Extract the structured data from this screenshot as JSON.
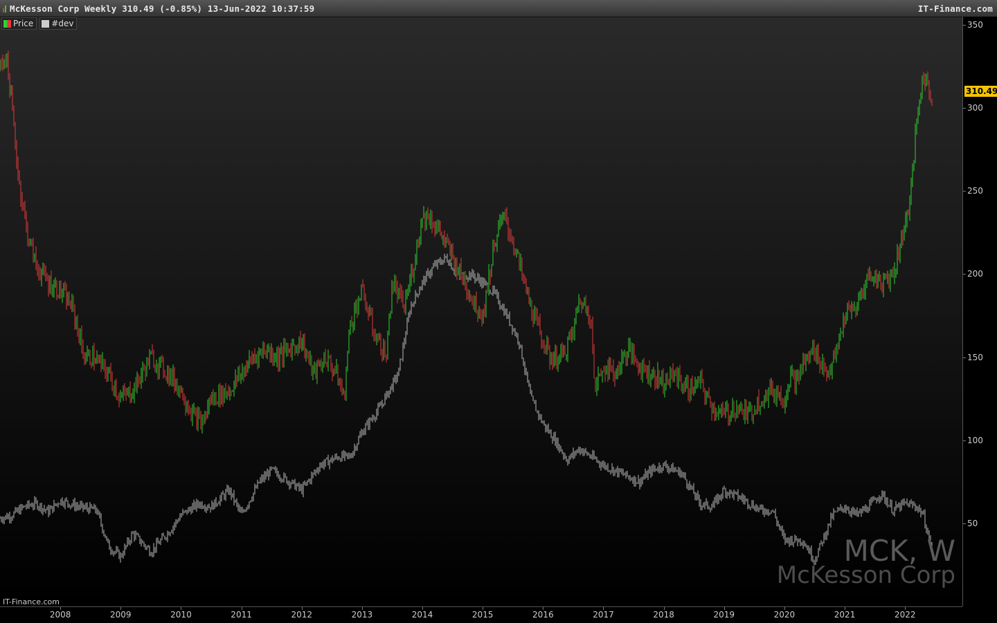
{
  "header": {
    "title": "McKesson Corp Weekly 310.49 (-0.85%) 13-Jun-2022 10:37:59",
    "site": "IT-Finance.com"
  },
  "legend": [
    {
      "label": "Price",
      "color": "#44cc44"
    },
    {
      "label": "#dev",
      "color": "#cccccc"
    }
  ],
  "last_price": "310.49",
  "watermark": {
    "code": "MCK, W",
    "name": "McKesson Corp"
  },
  "source": "IT-Finance.com",
  "colors": {
    "up": "#2fd12f",
    "down": "#e03a3a",
    "badge": "#f5c400",
    "background": "#000000"
  },
  "chart_data": {
    "type": "line",
    "title": "McKesson Corp Weekly 310.49 (-0.85%) 13-Jun-2022 10:37:59",
    "xlabel": "",
    "ylabel": "",
    "ylim": [
      0,
      355
    ],
    "x_ticks": [
      "2008",
      "2009",
      "2010",
      "2011",
      "2012",
      "2013",
      "2014",
      "2015",
      "2016",
      "2017",
      "2018",
      "2019",
      "2020",
      "2021",
      "2022"
    ],
    "y_ticks": [
      50,
      100,
      150,
      200,
      250,
      300,
      350
    ],
    "grid": false,
    "legend_position": "top-left",
    "series": [
      {
        "name": "Price",
        "x": [
          2007.0,
          2007.2,
          2007.4,
          2007.6,
          2007.8,
          2008.0,
          2008.3,
          2008.6,
          2008.8,
          2009.0,
          2009.2,
          2009.5,
          2009.8,
          2010.0,
          2010.3,
          2010.5,
          2010.8,
          2011.0,
          2011.3,
          2011.5,
          2011.8,
          2012.0,
          2012.3,
          2012.6,
          2012.8,
          2013.0,
          2013.3,
          2013.6,
          2013.8,
          2014.0,
          2014.2,
          2014.4,
          2014.6,
          2014.8,
          2015.0,
          2015.2,
          2015.4,
          2015.6,
          2015.8,
          2016.0,
          2016.2,
          2016.4,
          2016.6,
          2016.8,
          2017.0,
          2017.3,
          2017.6,
          2017.8,
          2018.0,
          2018.3,
          2018.6,
          2018.8,
          2019.0,
          2019.3,
          2019.6,
          2019.8,
          2020.0,
          2020.3,
          2020.5,
          2020.8,
          2021.0,
          2021.2,
          2021.4,
          2021.6,
          2021.8,
          2022.0,
          2022.2,
          2022.3,
          2022.45
        ],
        "values": [
          53,
          55,
          60,
          62,
          57,
          64,
          60,
          58,
          36,
          30,
          44,
          33,
          45,
          55,
          62,
          60,
          70,
          55,
          75,
          82,
          75,
          70,
          85,
          90,
          90,
          105,
          120,
          140,
          180,
          195,
          205,
          210,
          198,
          200,
          195,
          188,
          175,
          160,
          125,
          110,
          100,
          88,
          95,
          90,
          85,
          80,
          75,
          82,
          85,
          80,
          62,
          60,
          70,
          65,
          58,
          58,
          40,
          40,
          28,
          55,
          60,
          55,
          60,
          68,
          58,
          62,
          60,
          55,
          33
        ],
        "color": "#cccccc"
      },
      {
        "name": "#dev",
        "x": [
          2007.0,
          2007.1,
          2007.2,
          2007.3,
          2007.45,
          2007.6,
          2007.8,
          2008.0,
          2008.2,
          2008.4,
          2008.55,
          2008.8,
          2009.0,
          2009.2,
          2009.5,
          2009.8,
          2010.0,
          2010.2,
          2010.35,
          2010.5,
          2010.8,
          2011.0,
          2011.2,
          2011.4,
          2011.6,
          2011.8,
          2012.0,
          2012.2,
          2012.4,
          2012.6,
          2012.7,
          2012.8,
          2013.0,
          2013.2,
          2013.4,
          2013.5,
          2013.7,
          2013.85,
          2014.0,
          2014.1,
          2014.3,
          2014.5,
          2014.7,
          2014.9,
          2015.0,
          2015.2,
          2015.35,
          2015.5,
          2015.65,
          2015.8,
          2015.95,
          2016.1,
          2016.3,
          2016.5,
          2016.6,
          2016.8,
          2016.85,
          2017.0,
          2017.2,
          2017.4,
          2017.6,
          2017.8,
          2018.0,
          2018.2,
          2018.4,
          2018.6,
          2018.8,
          2019.0,
          2019.2,
          2019.4,
          2019.6,
          2019.8,
          2020.0,
          2020.1,
          2020.2,
          2020.3,
          2020.5,
          2020.7,
          2020.85,
          2021.0,
          2021.2,
          2021.4,
          2021.6,
          2021.8,
          2022.0,
          2022.1,
          2022.2,
          2022.3,
          2022.45
        ],
        "values": [
          325,
          332,
          300,
          260,
          225,
          205,
          195,
          190,
          180,
          150,
          150,
          140,
          125,
          130,
          150,
          140,
          130,
          115,
          110,
          125,
          130,
          140,
          150,
          155,
          150,
          155,
          160,
          140,
          150,
          138,
          125,
          170,
          190,
          165,
          150,
          195,
          180,
          205,
          235,
          235,
          225,
          210,
          195,
          180,
          175,
          220,
          235,
          220,
          200,
          180,
          165,
          150,
          150,
          165,
          185,
          175,
          130,
          145,
          140,
          155,
          145,
          140,
          135,
          140,
          130,
          135,
          120,
          115,
          120,
          115,
          125,
          130,
          125,
          140,
          135,
          145,
          155,
          140,
          150,
          175,
          180,
          200,
          195,
          200,
          230,
          250,
          295,
          320,
          305
        ],
        "color": "#2fd12f"
      }
    ]
  }
}
